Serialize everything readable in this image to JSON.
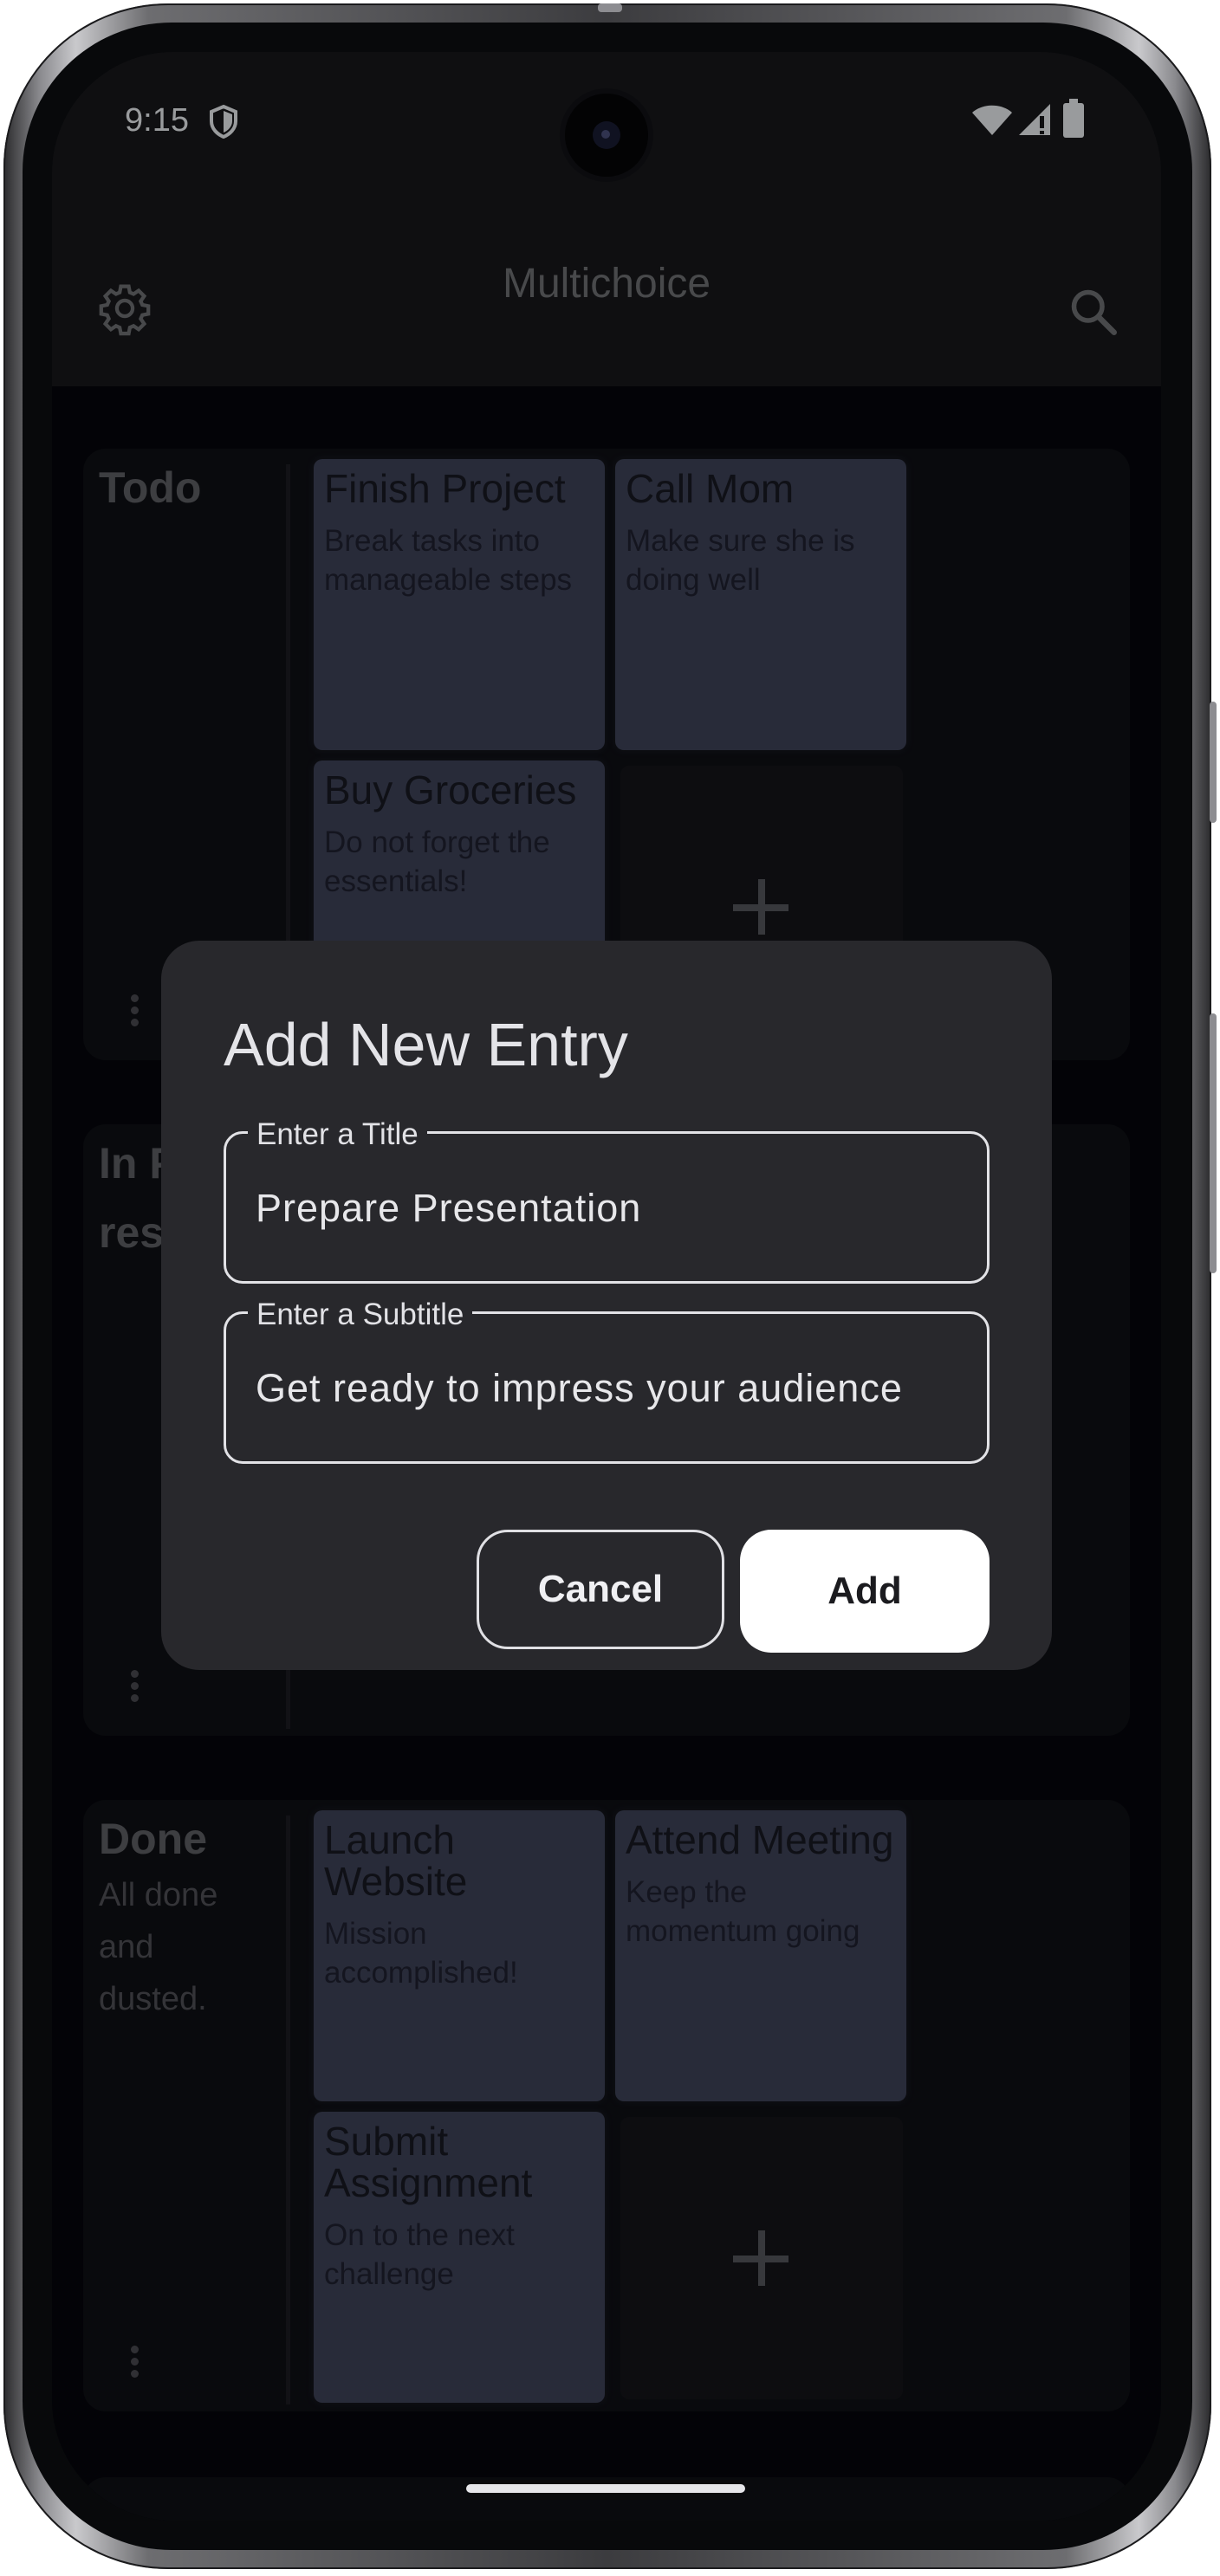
{
  "status_bar": {
    "time": "9:15",
    "icons": [
      "shield-icon",
      "wifi-icon",
      "signal-icon",
      "battery-icon"
    ]
  },
  "app_bar": {
    "title": "Multichoice",
    "left_icon": "gear-icon",
    "right_icon": "search-icon"
  },
  "sections": [
    {
      "title": "Todo",
      "subtitle": "",
      "cards": [
        {
          "title": "Finish Project",
          "subtitle": "Break tasks into manageable steps"
        },
        {
          "title": "Call Mom",
          "subtitle": "Make sure she is doing well"
        },
        {
          "title": "Buy Groceries",
          "subtitle": "Do not forget the essentials!"
        }
      ]
    },
    {
      "title": "In Pro…",
      "title_visible_line1": "In P",
      "title_visible_line2": "res",
      "subtitle": "",
      "cards": []
    },
    {
      "title": "Done",
      "subtitle": "All done and dusted.",
      "cards": [
        {
          "title": "Launch Website",
          "subtitle": "Mission accomplished!"
        },
        {
          "title": "Attend Meeting",
          "subtitle": "Keep the momentum going"
        },
        {
          "title": "Submit Assignment",
          "subtitle": "On to the next challenge"
        }
      ]
    }
  ],
  "dialog": {
    "title": "Add New Entry",
    "title_field": {
      "label": "Enter a Title",
      "value": "Prepare Presentation"
    },
    "subtitle_field": {
      "label": "Enter a Subtitle",
      "value": "Get ready to impress your audience"
    },
    "cancel_label": "Cancel",
    "add_label": "Add"
  },
  "colors": {
    "background": "#06070b",
    "card": "#3e4258",
    "dialog": "#28282c",
    "primary_button": "#ffffff"
  }
}
